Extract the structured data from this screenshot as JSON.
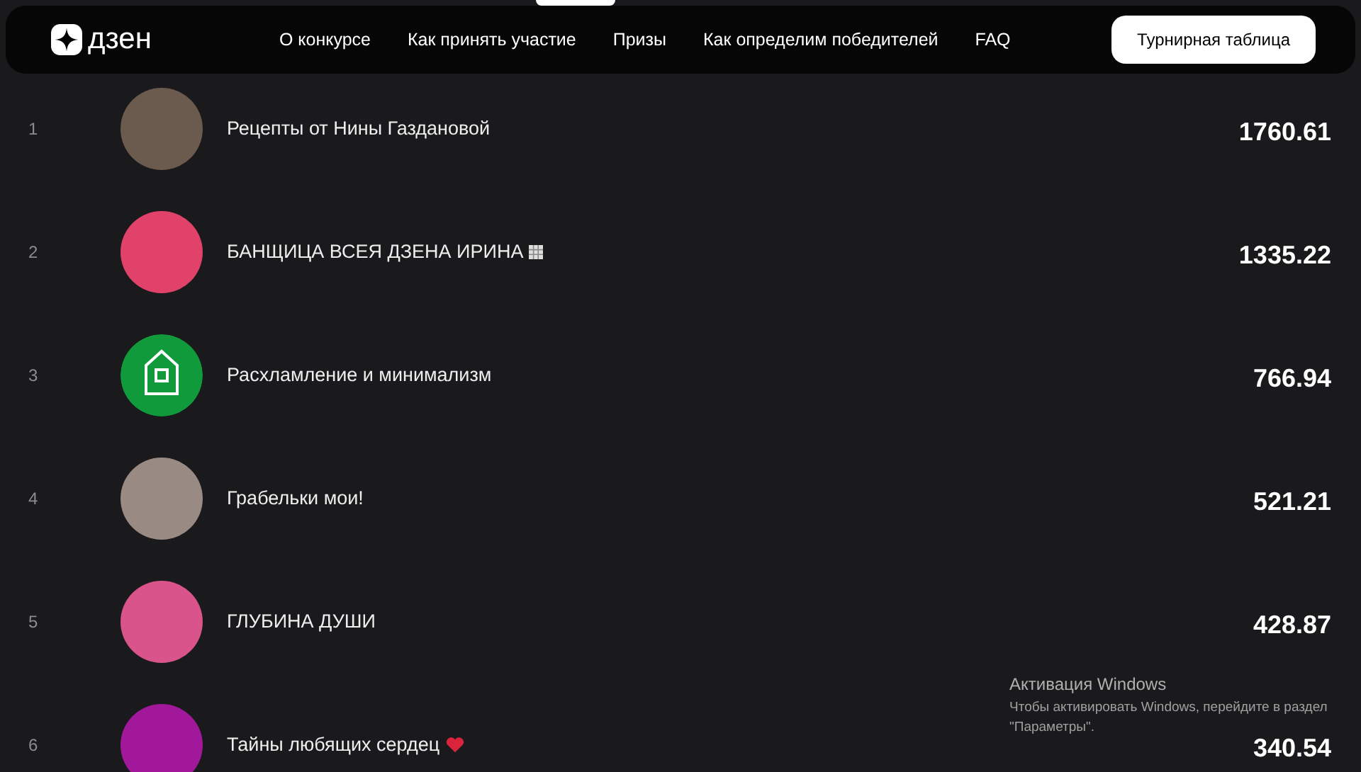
{
  "header": {
    "logo": "дзен",
    "nav": [
      {
        "label": "О конкурсе"
      },
      {
        "label": "Как принять участие"
      },
      {
        "label": "Призы"
      },
      {
        "label": "Как определим победителей"
      },
      {
        "label": "FAQ"
      }
    ],
    "button": "Турнирная таблица"
  },
  "leaderboard": [
    {
      "rank": "1",
      "name": "Рецепты от Нины Газдановой",
      "score": "1760.61",
      "kind": "photo",
      "color": "#6b5a4e"
    },
    {
      "rank": "2",
      "name": "БАНЩИЦА ВСЕЯ ДЗЕНА ИРИНА",
      "score": "1335.22",
      "kind": "photo",
      "color": "#e0426a",
      "badge": {
        "kind": "box"
      }
    },
    {
      "rank": "3",
      "name": "Расхламление и минимализм",
      "score": "766.94",
      "kind": "house",
      "color": "#119a3c"
    },
    {
      "rank": "4",
      "name": "Грабельки мои!",
      "score": "521.21",
      "kind": "photo",
      "color": "#9a8a84"
    },
    {
      "rank": "5",
      "name": "ГЛУБИНА ДУШИ",
      "score": "428.87",
      "kind": "photo",
      "color": "#d9548a"
    },
    {
      "rank": "6",
      "name": "Тайны любящих сердец",
      "score": "340.54",
      "kind": "photo",
      "color": "#a2189a",
      "badge": {
        "kind": "heart"
      }
    }
  ],
  "os_overlay": {
    "title": "Активация Windows",
    "text": "Чтобы активировать Windows, перейдите в раздел \"Параметры\"."
  }
}
